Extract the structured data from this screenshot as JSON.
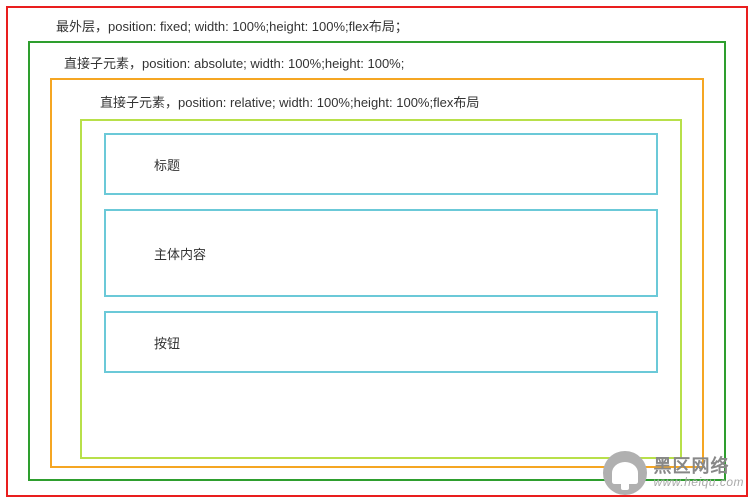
{
  "labels": {
    "outer": "最外层，position: fixed; width: 100%;height: 100%;flex布局；",
    "absolute": "直接子元素，position: absolute; width: 100%;height: 100%;",
    "relative": "直接子元素，position: relative; width: 100%;height: 100%;flex布局"
  },
  "boxes": {
    "title": "标题",
    "body": "主体内容",
    "button": "按钮"
  },
  "watermark": {
    "brand": "黑区网络",
    "url": "www.heiqu.com"
  }
}
